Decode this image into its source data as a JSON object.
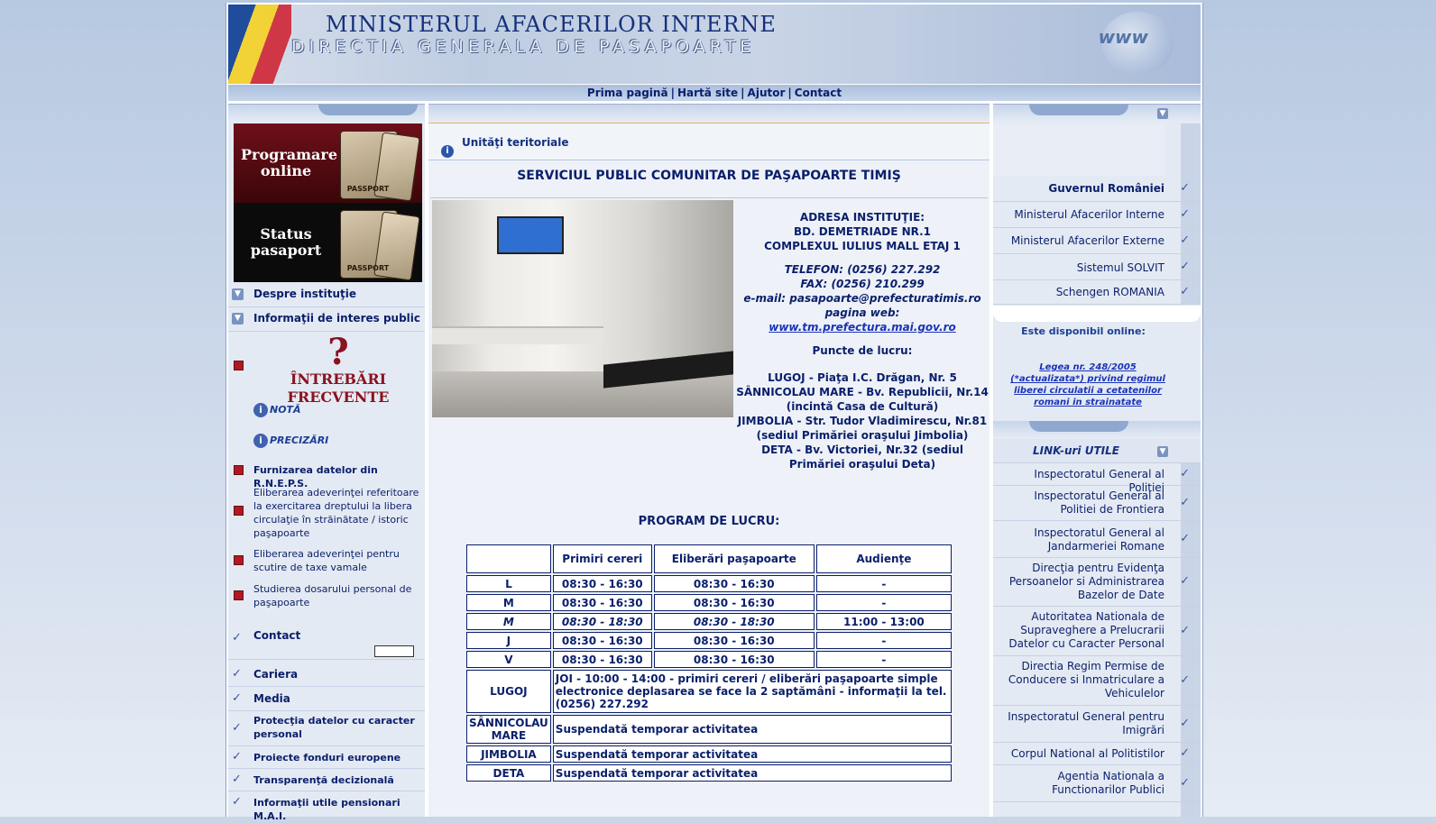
{
  "header": {
    "title": "MINISTERUL AFACERILOR INTERNE",
    "subtitle": "DIRECTIA GENERALA DE PASAPOARTE",
    "logo_text": "www"
  },
  "topnav": {
    "items": [
      "Prima pagină",
      "Hartă site",
      "Ajutor",
      "Contact"
    ],
    "separator": "|"
  },
  "left": {
    "promo1": {
      "label": "Programare online",
      "passport_label": "PASSPORT"
    },
    "promo2": {
      "label": "Status pasaport",
      "passport_label": "PASSPORT"
    },
    "menu": [
      {
        "label": "Despre instituţie",
        "icon": "chevron-down-icon"
      },
      {
        "label": "Informaţii de interes public",
        "icon": "chevron-down-icon"
      }
    ],
    "faq": {
      "mark": "?",
      "label_line1": "ÎNTREBĂRI",
      "label_line2": "FRECVENTE"
    },
    "notes": [
      {
        "label": "NOTĂ"
      },
      {
        "label": "PRECIZĂRI"
      }
    ],
    "red_items": [
      "Furnizarea datelor din R.N.E.P.S.",
      "Eliberarea adeverinţei referitoare la exercitarea dreptului la libera circulaţie în străinătate / istoric paşapoarte",
      "Eliberarea adeverinţei pentru scutire de taxe vamale",
      "Studierea dosarului personal de paşapoarte"
    ],
    "contact": "Contact",
    "check_items": [
      "Cariera",
      "Media",
      "Protecţia datelor cu caracter personal",
      "Proiecte fonduri europene",
      "Transparenţă decizională",
      "Informaţii utile pensionari M.A.I."
    ]
  },
  "center": {
    "breadcrumb": "Unităţi teritoriale",
    "title": "SERVICIUL PUBLIC COMUNITAR DE PAŞAPOARTE TIMIŞ",
    "address": {
      "line1": "ADRESA INSTITUŢIE:",
      "line2": "BD. DEMETRIADE NR.1",
      "line3": "COMPLEXUL IULIUS MALL ETAJ 1",
      "phone": "TELEFON: (0256) 227.292",
      "fax": "FAX:  (0256) 210.299",
      "email": "e-mail: pasapoarte@prefecturatimis.ro",
      "web_label": "pagina web: ",
      "web_link": "www.tm.prefectura.mai.gov.ro",
      "points_title": "Puncte de lucru:",
      "points": [
        "LUGOJ - Piaţa I.C. Drăgan, Nr. 5",
        "SÂNNICOLAU MARE - Bv. Republicii, Nr.14 (incintă Casa de Cultură)",
        "JIMBOLIA - Str. Tudor Vladimirescu, Nr.81 (sediul Primăriei oraşului Jimbolia)",
        "DETA - Bv. Victoriei, Nr.32 (sediul Primăriei oraşului Deta)"
      ]
    },
    "program_title": "PROGRAM DE LUCRU:",
    "table": {
      "headers": [
        "Primiri cereri",
        "Eliberări paşapoarte",
        "Audienţe"
      ],
      "rows": [
        {
          "day": "L",
          "a": "08:30 - 16:30",
          "b": "08:30 - 16:30",
          "c": "-",
          "italic": false
        },
        {
          "day": "M",
          "a": "08:30 - 16:30",
          "b": "08:30 - 16:30",
          "c": "-",
          "italic": false
        },
        {
          "day": "M",
          "a": "08:30 - 18:30",
          "b": "08:30 - 18:30",
          "c": "11:00 - 13:00",
          "italic": true
        },
        {
          "day": "J",
          "a": "08:30 - 16:30",
          "b": "08:30 - 16:30",
          "c": "-",
          "italic": false
        },
        {
          "day": "V",
          "a": "08:30 - 16:30",
          "b": "08:30 - 16:30",
          "c": "-",
          "italic": false
        }
      ],
      "locations": [
        {
          "name": "LUGOJ",
          "text": "JOI - 10:00 - 14:00 - primiri cereri / eliberări paşapoarte simple electronice deplasarea se face la 2 saptămâni - informaţii la tel. (0256) 227.292"
        },
        {
          "name": "SÂNNICOLAU MARE",
          "text": "Suspendată temporar activitatea"
        },
        {
          "name": "JIMBOLIA",
          "text": "Suspendată temporar activitatea"
        },
        {
          "name": "DETA",
          "text": "Suspendată temporar activitatea"
        }
      ]
    }
  },
  "right": {
    "links_top": [
      "Guvernul României",
      "Ministerul Afacerilor Interne",
      "Ministerul Afacerilor Externe",
      "Sistemul SOLVIT",
      "Schengen ROMANIA"
    ],
    "available_online": "Este disponibil online:",
    "law_link": "Legea nr. 248/2005 (*actualizata*) privind regimul liberei circulatii a cetatenilor romani in strainatate",
    "links_title": "LINK-uri UTILE",
    "useful_links": [
      "Inspectoratul General al Politiei",
      "Inspectoratul General al Politiei de Frontiera",
      "Inspectoratul General al Jandarmeriei Romane",
      "Direcţia pentru Evidenţa Persoanelor si Administrarea Bazelor de Date",
      "Autoritatea Nationala de Supraveghere a Prelucrarii Datelor cu Caracter Personal",
      "Directia Regim Permise de Conducere si Inmatriculare a Vehiculelor",
      "Inspectoratul General pentru Imigrări",
      "Corpul National al Politistilor",
      "Agentia Nationala a Functionarilor Publici"
    ]
  },
  "colors": {
    "accent": "#0a1f6b",
    "link": "#1a33b8",
    "faq": "#8b1220",
    "bullet_red": "#b01921"
  }
}
